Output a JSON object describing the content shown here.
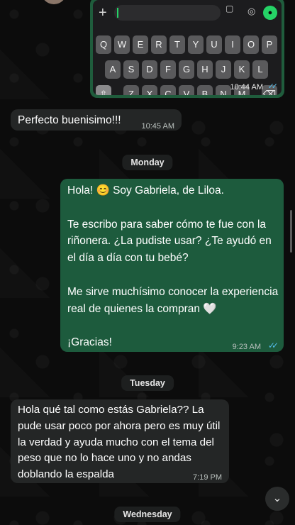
{
  "top_partial": {
    "keyboard_row1": [
      "Q",
      "W",
      "E",
      "R",
      "T",
      "Y",
      "U",
      "I",
      "O",
      "P"
    ],
    "keyboard_row2": [
      "A",
      "S",
      "D",
      "F",
      "G",
      "H",
      "J",
      "K",
      "L"
    ],
    "keyboard_row3": [
      "⇧",
      "Z",
      "X",
      "C",
      "V",
      "B",
      "N",
      "M",
      "⌫"
    ],
    "image_time": "10:44 AM",
    "icons": {
      "plus": "+",
      "camera": "📷",
      "sticker": "🗒",
      "mic": "🎤"
    }
  },
  "messages": [
    {
      "id": "m1",
      "direction": "incoming",
      "text": "Perfecto buenisimo!!!",
      "time": "10:45 AM"
    },
    {
      "id": "m2",
      "direction": "outgoing",
      "text": "Hola! 😊 Soy Gabriela, de Liloa.\n\nTe escribo para saber cómo te fue con la riñonera. ¿La pudiste usar? ¿Te ayudó en el día a día con tu bebé?\n\nMe sirve muchísimo conocer la experiencia real de quienes la compran 🤍\n\n¡Gracias!",
      "time": "9:23 AM",
      "status": "read"
    },
    {
      "id": "m3",
      "direction": "incoming",
      "text": "Hola qué tal como estás Gabriela?? La pude usar poco por ahora pero es muy útil la verdad y ayuda mucho con el tema del peso que no lo hace uno y no andas doblando la espalda",
      "time": "7:19 PM"
    }
  ],
  "day_labels": {
    "monday": "Monday",
    "tuesday": "Tuesday",
    "wednesday": "Wednesday"
  },
  "scroll_button_icon": "⌄",
  "tick_glyph": "✓✓"
}
